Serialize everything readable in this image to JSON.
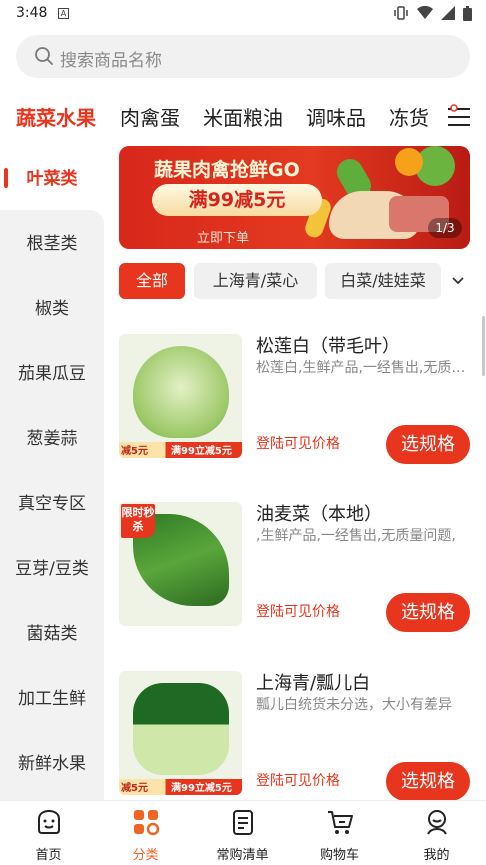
{
  "status_bar": {
    "time": "3:48",
    "notif_icon": "A",
    "icons": [
      "vibrate-icon",
      "wifi-icon",
      "signal-icon",
      "battery-icon"
    ]
  },
  "search": {
    "placeholder": "搜索商品名称"
  },
  "top_categories": [
    "蔬菜水果",
    "肉禽蛋",
    "米面粮油",
    "调味品",
    "冻货"
  ],
  "active_top_category": "蔬菜水果",
  "sidebar": {
    "items": [
      "叶菜类",
      "根茎类",
      "椒类",
      "茄果瓜豆",
      "葱姜蒜",
      "真空专区",
      "豆芽/豆类",
      "菌菇类",
      "加工生鲜",
      "新鲜水果"
    ],
    "active": "叶菜类"
  },
  "banner": {
    "title": "蔬果肉禽抢鲜GO",
    "deal": "满99减5元",
    "cta": "立即下单",
    "page": "1/3"
  },
  "filter_chips": {
    "items": [
      "全部",
      "上海青/菜心",
      "白菜/娃娃菜"
    ],
    "active": "全部"
  },
  "products": [
    {
      "name": "松莲白（带毛叶）",
      "desc": "松莲白,生鲜产品,一经售出,无质量问题",
      "price_text": "登陆可见价格",
      "button": "选规格",
      "tag_left": "减5元",
      "tag_right": "满99立减5元",
      "flash": "",
      "color": "#b8d98a"
    },
    {
      "name": "油麦菜（本地）",
      "desc": ",生鲜产品,一经售出,无质量问题,",
      "price_text": "登陆可见价格",
      "button": "选规格",
      "tag_left": "",
      "tag_right": "",
      "flash": "限时秒杀",
      "color": "#3d8a2c"
    },
    {
      "name": "上海青/瓢儿白",
      "desc": "瓢儿白统货未分选，大小有差异",
      "price_text": "登陆可见价格",
      "button": "选规格",
      "tag_left": "减5元",
      "tag_right": "满99立减5元",
      "flash": "",
      "color": "#2f7a2a"
    }
  ],
  "tabbar": {
    "items": [
      {
        "label": "首页",
        "icon": "home-icon"
      },
      {
        "label": "分类",
        "icon": "category-icon"
      },
      {
        "label": "常购清单",
        "icon": "list-icon"
      },
      {
        "label": "购物车",
        "icon": "cart-icon"
      },
      {
        "label": "我的",
        "icon": "profile-icon"
      }
    ],
    "active": "分类"
  },
  "colors": {
    "accent": "#e8351d",
    "tab_active": "#f06424"
  }
}
